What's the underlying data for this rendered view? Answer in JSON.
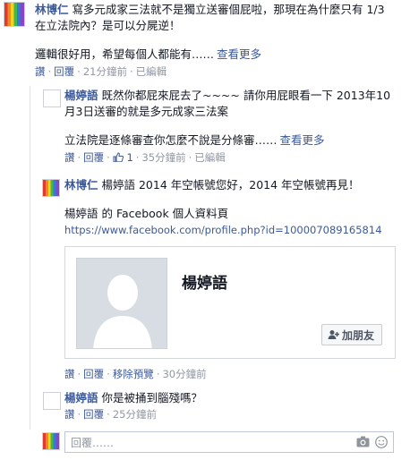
{
  "comment1": {
    "author": "林博仁",
    "line1": " 寫多元成家三法就不是獨立送審個屁啦，那現在為什麼只有 1/3",
    "line2": "在立法院內？是可以分屍逆！",
    "line3": "邏輯很好用，希望每個人都能有……",
    "see_more": "查看更多",
    "like": "讚",
    "reply": "回覆",
    "time": "21分鐘前",
    "edited": "已編輯"
  },
  "reply1": {
    "author": "楊婷語",
    "line1": " 既然你都屁來屁去了~~~~ 請你用屁眼看一下 2013年10",
    "line2": "月3日送審的就是多元成家三法案",
    "line3": "立法院是逐條審查你怎麼不說是分條審……",
    "see_more": "查看更多",
    "like": "讚",
    "reply": "回覆",
    "like_count": "1",
    "time": "35分鐘前",
    "edited": "已編輯"
  },
  "reply2": {
    "author": "林博仁",
    "line1": " 楊婷語 2014 年空帳號您好，2014 年空帳號再見！",
    "line2": "楊婷語 的 Facebook 個人資料頁",
    "link": "https://www.facebook.com/profile.php?id=100007089165814",
    "card_name": "楊婷語",
    "add_friend": "加朋友",
    "like": "讚",
    "reply": "回覆",
    "remove_preview": "移除預覽",
    "time": "30分鐘前"
  },
  "reply3": {
    "author": "楊婷語",
    "line1": " 你是被捅到腦殘嗎？",
    "like": "讚",
    "reply": "回覆",
    "time": "25分鐘前"
  },
  "reply_box": {
    "placeholder": "回覆……"
  },
  "icons": {
    "camera": "camera-icon",
    "smiley": "smiley-icon",
    "like": "thumbs-up-icon",
    "add_friend": "add-friend-icon"
  }
}
